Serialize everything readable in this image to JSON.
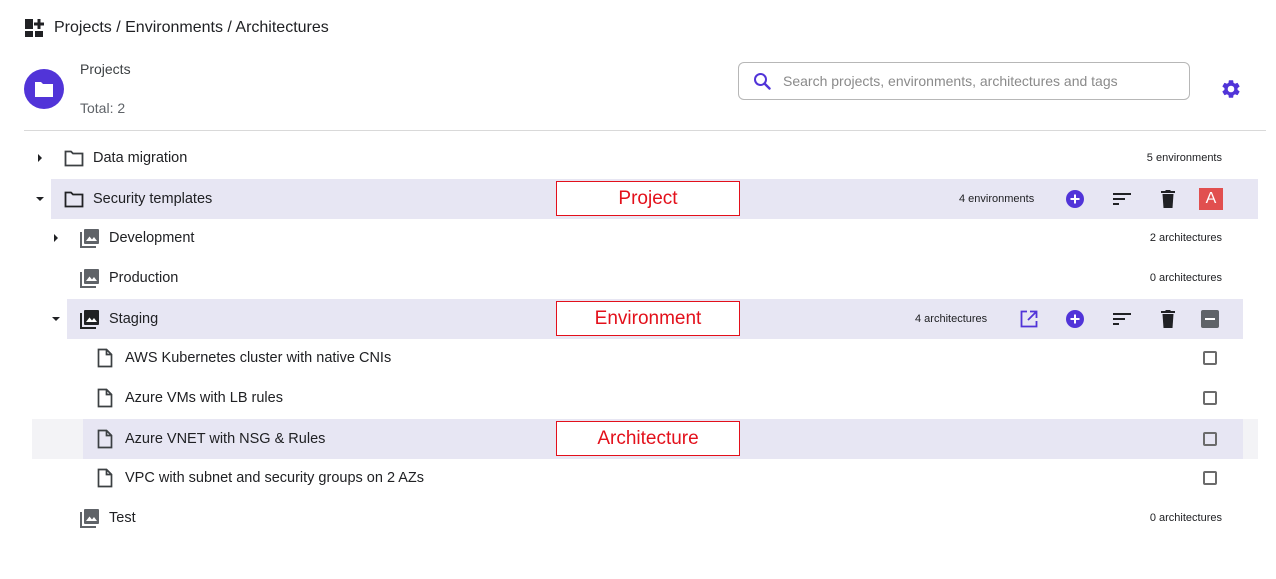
{
  "breadcrumb": {
    "text": "Projects / Environments / Architectures",
    "icon": "dashboard-add-icon"
  },
  "header": {
    "title": "Projects",
    "total": "Total: 2",
    "avatar_icon": "folder-icon"
  },
  "search": {
    "placeholder": "Search projects, environments, architectures and tags",
    "icon": "search-icon"
  },
  "settings": {
    "icon": "gear-icon"
  },
  "colors": {
    "accent": "#5134d8",
    "highlight": "#e7e6f3",
    "annotation": "#e3101b",
    "badge": "#e14f4f"
  },
  "tree": {
    "projects": [
      {
        "name": "Data migration",
        "count": "5 environments",
        "expanded": false
      },
      {
        "name": "Security templates",
        "count": "4 environments",
        "expanded": true,
        "badge": "A",
        "environments": [
          {
            "name": "Development",
            "count": "2 architectures",
            "expanded": false
          },
          {
            "name": "Production",
            "count": "0 architectures"
          },
          {
            "name": "Staging",
            "count": "4 architectures",
            "expanded": true,
            "architectures": [
              {
                "name": "AWS Kubernetes cluster with native CNIs"
              },
              {
                "name": "Azure VMs with LB rules"
              },
              {
                "name": "Azure VNET with NSG & Rules"
              },
              {
                "name": "VPC with subnet and security groups on 2 AZs"
              }
            ]
          },
          {
            "name": "Test",
            "count": "0 architectures"
          }
        ]
      }
    ]
  },
  "annotations": {
    "project": "Project",
    "environment": "Environment",
    "architecture": "Architecture"
  }
}
